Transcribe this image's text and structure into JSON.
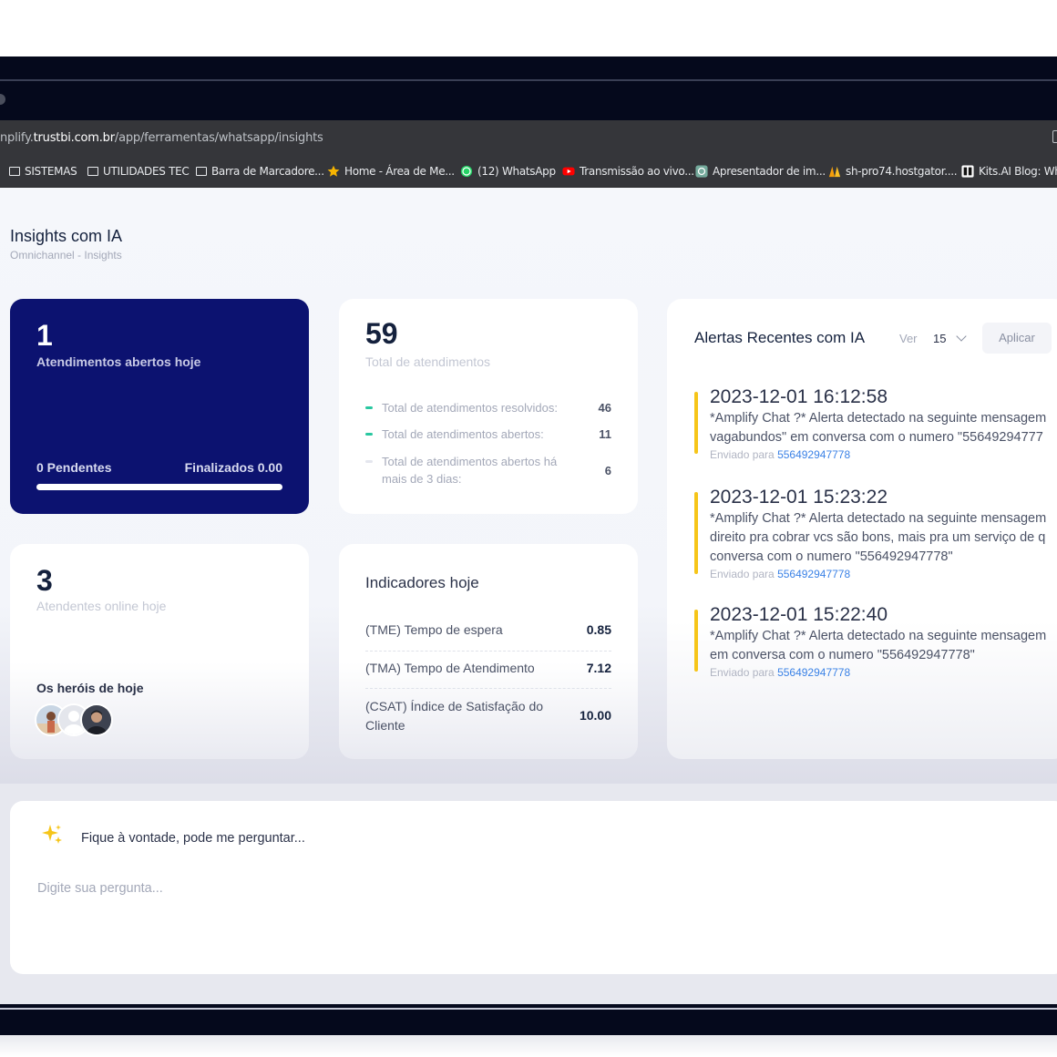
{
  "browser": {
    "url_prefix": "nplify.",
    "url_host": "trustbi.com.br",
    "url_path": "/app/ferramentas/whatsapp/insights",
    "bookmarks": [
      {
        "label": "SISTEMAS",
        "icon": "folder-icon"
      },
      {
        "label": "UTILIDADES TEC",
        "icon": "folder-icon"
      },
      {
        "label": "Barra de Marcadore...",
        "icon": "folder-icon"
      },
      {
        "label": "Home - Área de Me...",
        "icon": "star-icon"
      },
      {
        "label": "(12) WhatsApp",
        "icon": "whatsapp-icon"
      },
      {
        "label": "Transmissão ao vivo...",
        "icon": "youtube-icon"
      },
      {
        "label": "Apresentador de im...",
        "icon": "openai-icon"
      },
      {
        "label": "sh-pro74.hostgator....",
        "icon": "hostgator-icon"
      },
      {
        "label": "Kits.AI Blog: Wha",
        "icon": "kits-icon"
      }
    ]
  },
  "header": {
    "title": "Insights com IA",
    "breadcrumb": "Omnichannel  -  Insights"
  },
  "today_card": {
    "count": "1",
    "label": "Atendimentos abertos hoje",
    "pending": "0 Pendentes",
    "finished": "Finalizados 0.00",
    "progress": 1.0
  },
  "total_card": {
    "count": "59",
    "label": "Total de atendimentos",
    "stats": [
      {
        "label": "Total de atendimentos resolvidos:",
        "value": "46"
      },
      {
        "label": "Total de atendimentos abertos:",
        "value": "11"
      },
      {
        "label": "Total de atendimentos abertos há mais de 3 dias:",
        "value": "6"
      }
    ]
  },
  "online_card": {
    "count": "3",
    "label": "Atendentes online hoje",
    "heroes_label": "Os heróis de hoje"
  },
  "indicators_card": {
    "title": "Indicadores hoje",
    "rows": [
      {
        "label": "(TME) Tempo de espera",
        "value": "0.85"
      },
      {
        "label": "(TMA) Tempo de Atendimento",
        "value": "7.12"
      },
      {
        "label": "(CSAT) Índice de Satisfação do Cliente",
        "value": "10.00"
      }
    ]
  },
  "alerts_card": {
    "title": "Alertas Recentes com IA",
    "ver_label": "Ver",
    "ver_value": "15",
    "apply_label": "Aplicar",
    "sent_prefix": "Enviado para",
    "alerts": [
      {
        "date": "2023-12-01 16:12:58",
        "lines": [
          "*Amplify Chat ?* Alerta detectado na seguinte mensagem",
          "vagabundos\" em conversa com o numero \"55649294777"
        ],
        "sent_to": "556492947778"
      },
      {
        "date": "2023-12-01 15:23:22",
        "lines": [
          "*Amplify Chat ?* Alerta detectado na seguinte mensagem",
          "direito pra cobrar vcs são bons, mais pra um serviço de q",
          "conversa com o numero \"556492947778\""
        ],
        "sent_to": "556492947778"
      },
      {
        "date": "2023-12-01 15:22:40",
        "lines": [
          "*Amplify Chat ?* Alerta detectado na seguinte mensagem",
          "em conversa com o numero \"556492947778\""
        ],
        "sent_to": "556492947778"
      }
    ]
  },
  "assistant": {
    "prompt": "Fique à vontade, pode me perguntar...",
    "placeholder": "Digite sua pergunta..."
  },
  "colors": {
    "primary_dark_blue": "#0c1270",
    "accent_green": "#29c7a0",
    "alert_yellow": "#f6c519",
    "link_blue": "#3b82e6"
  }
}
